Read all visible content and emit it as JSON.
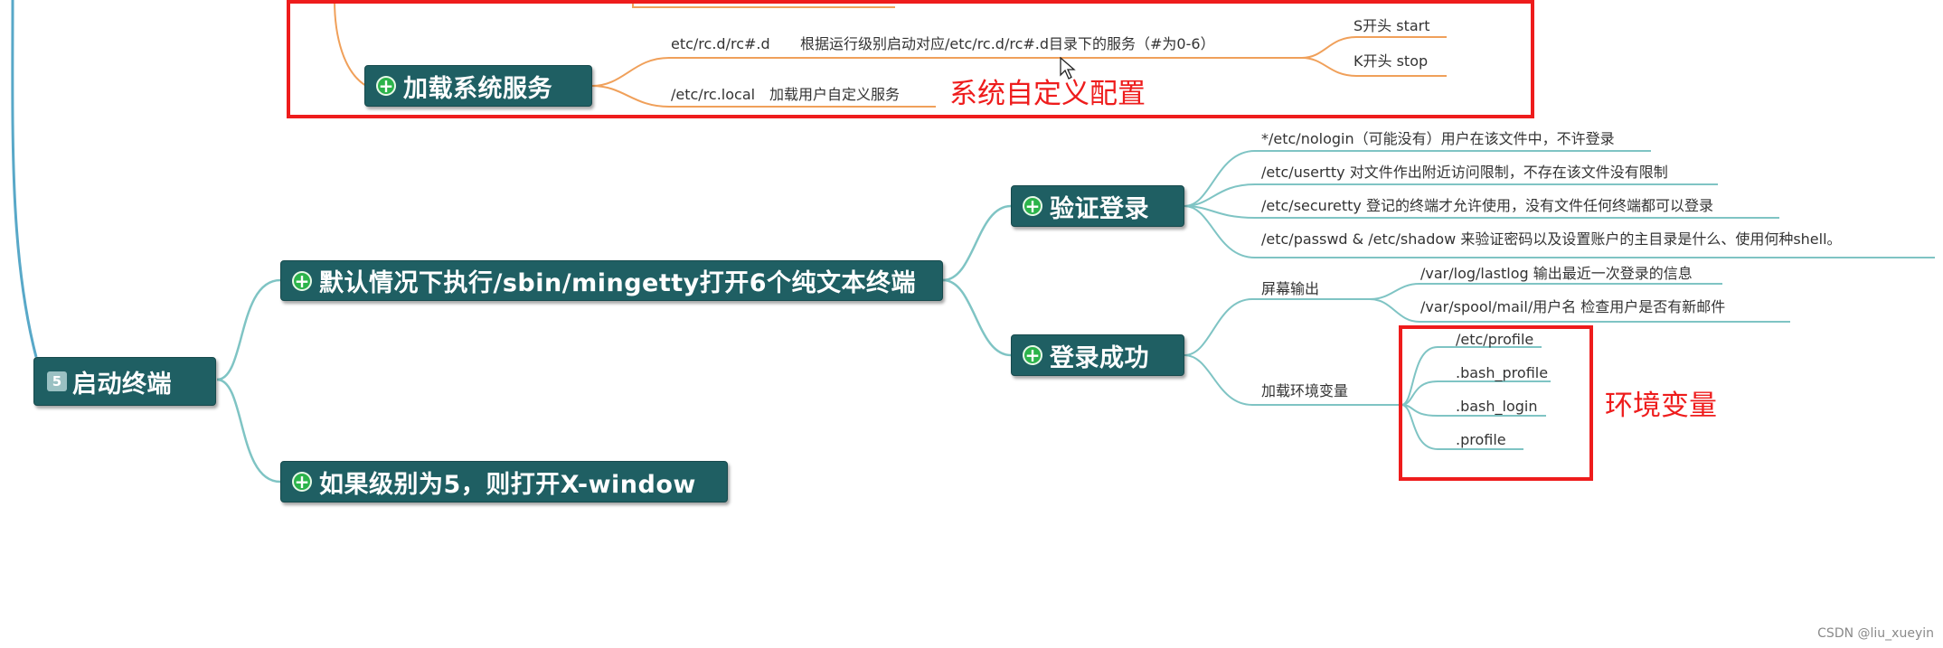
{
  "nodes": {
    "jiazai_xitong_fuwu": "加载系统服务",
    "qidong_zhongduan_num": "5",
    "qidong_zhongduan": "启动终端",
    "mingetty": "默认情况下执行/sbin/mingetty打开6个纯文本终端",
    "xwindow": "如果级别为5，则打开X-window",
    "yanzheng_denglu": "验证登录",
    "denglu_chenggong": "登录成功"
  },
  "leaves": {
    "rcd_path": "etc/rc.d/rc#.d",
    "rcd_desc": "根据运行级别启动对应/etc/rc.d/rc#.d目录下的服务（#为0-6）",
    "s_start": "S开头 start",
    "k_stop": "K开头 stop",
    "rclocal_path": "/etc/rc.local",
    "rclocal_desc": "加载用户自定义服务",
    "nologin": "*/etc/nologin（可能没有）用户在该文件中，不许登录",
    "usertty": "/etc/usertty  对文件作出附近访问限制，不存在该文件没有限制",
    "securetty": "/etc/securetty   登记的终端才允许使用，没有文件任何终端都可以登录",
    "passwd": "/etc/passwd & /etc/shadow  来验证密码以及设置账户的主目录是什么、使用何种shell。",
    "screen_output": "屏幕输出",
    "lastlog": "/var/log/lastlog   输出最近一次登录的信息",
    "spool_mail": "/var/spool/mail/用户名    检查用户是否有新邮件",
    "load_env": "加载环境变量",
    "etc_profile": "/etc/profile",
    "bash_profile": ".bash_profile",
    "bash_login": ".bash_login",
    "profile": ".profile"
  },
  "annotations": {
    "custom_config": "系统自定义配置",
    "env_vars": "环境变量"
  },
  "watermark": "CSDN @liu_xueyin",
  "colors": {
    "node_bg": "#1f5f63",
    "plus_green": "#2bb34a",
    "link_orange": "#f0a05a",
    "link_teal": "#7fc4c4",
    "link_blue": "#58a8c8",
    "annotation_red": "#ee1c1c"
  }
}
